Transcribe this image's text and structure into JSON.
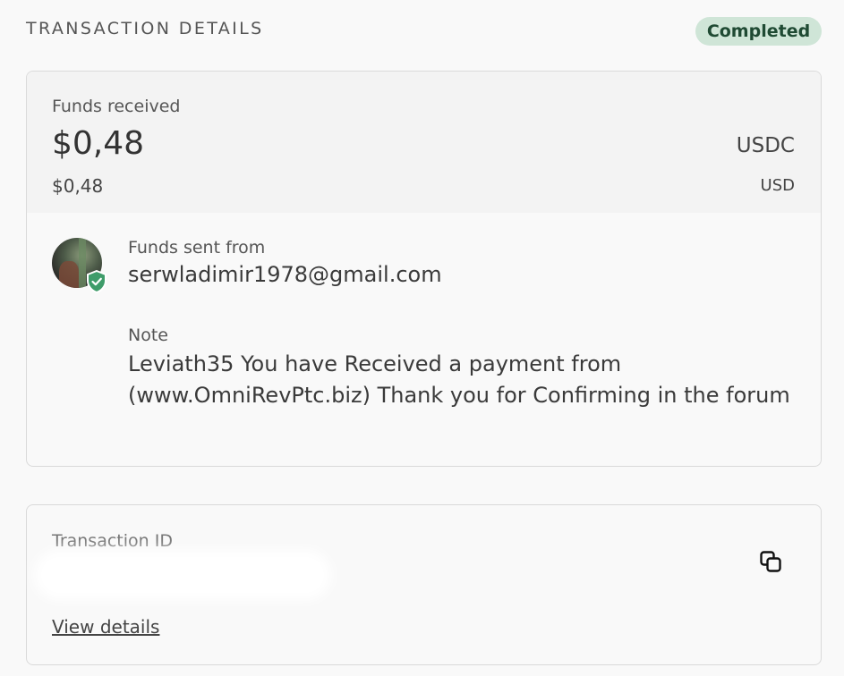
{
  "header": {
    "title": "TRANSACTION DETAILS",
    "status": "Completed"
  },
  "amount": {
    "label": "Funds received",
    "value": "$0,48",
    "currency": "USDC",
    "converted_value": "$0,48",
    "converted_currency": "USD"
  },
  "sender": {
    "label": "Funds sent from",
    "email": "serwladimir1978@gmail.com",
    "avatar_icon": "avatar-photo",
    "verified_icon": "shield-check-icon"
  },
  "note": {
    "label": "Note",
    "text": "Leviath35 You have Received a payment from (www.OmniRevPtc.biz) Thank you for Confirming in the forum"
  },
  "transaction": {
    "id_label": "Transaction ID",
    "copy_icon": "copy-icon",
    "view_details": "View details"
  },
  "colors": {
    "status_badge_bg": "#cfe5d7",
    "status_badge_text": "#1f4a33",
    "shield_green": "#3f9c6a"
  }
}
